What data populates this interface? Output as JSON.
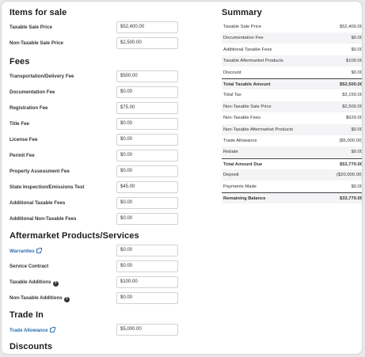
{
  "items_for_sale": {
    "title": "Items for sale",
    "rows": [
      {
        "label": "Taxable Sale Price",
        "value": "$52,400.00"
      },
      {
        "label": "Non-Taxable Sale Price",
        "value": "$2,500.00"
      }
    ]
  },
  "fees": {
    "title": "Fees",
    "rows": [
      {
        "label": "Transportation/Delivery Fee",
        "value": "$500.00"
      },
      {
        "label": "Documentation Fee",
        "value": "$0.00"
      },
      {
        "label": "Registration Fee",
        "value": "$75.00"
      },
      {
        "label": "Title Fee",
        "value": "$0.00"
      },
      {
        "label": "License Fee",
        "value": "$0.00"
      },
      {
        "label": "Permit Fee",
        "value": "$0.00"
      },
      {
        "label": "Property Assessment Fee",
        "value": "$0.00"
      },
      {
        "label": "State Inspection/Emissions Test",
        "value": "$45.00"
      },
      {
        "label": "Additional Taxable Fees",
        "value": "$0.00"
      },
      {
        "label": "Additional Non-Taxable Fees",
        "value": "$0.00"
      }
    ]
  },
  "aftermarket": {
    "title": "Aftermarket Products/Services",
    "rows": [
      {
        "label": "Warranties",
        "value": "$0.00",
        "link": true
      },
      {
        "label": "Service Contract",
        "value": "$0.00"
      },
      {
        "label": "Taxable Additions",
        "value": "$100.00",
        "help": true
      },
      {
        "label": "Non-Taxable Additions",
        "value": "$0.00",
        "help": true
      }
    ]
  },
  "trade_in": {
    "title": "Trade In",
    "rows": [
      {
        "label": "Trade Allowance",
        "value": "$5,000.00",
        "link": true
      }
    ]
  },
  "discounts": {
    "title": "Discounts"
  },
  "summary": {
    "title": "Summary",
    "rows": [
      {
        "label": "Taxable Sale Price",
        "value": "$52,400.00"
      },
      {
        "label": "Documentation Fee",
        "value": "$0.00"
      },
      {
        "label": "Additional Taxable Fees",
        "value": "$0.00"
      },
      {
        "label": "Taxable Aftermarket Products",
        "value": "$100.00"
      },
      {
        "label": "Discount",
        "value": "$0.00"
      },
      {
        "label": "Total Taxable Amount",
        "value": "$52,500.00",
        "bold": true,
        "rule": true
      },
      {
        "label": "Total Tax",
        "value": "$3,150.00"
      },
      {
        "label": "Non-Taxable Sale Price",
        "value": "$2,500.00"
      },
      {
        "label": "Non-Taxable Fees",
        "value": "$620.00"
      },
      {
        "label": "Non-Taxable Aftermarket Products",
        "value": "$0.00"
      },
      {
        "label": "Trade Allowance",
        "value": "($5,000.00)"
      },
      {
        "label": "Rebate",
        "value": "$0.00"
      },
      {
        "label": "Total Amount Due",
        "value": "$53,770.00",
        "bold": true,
        "rule": true
      },
      {
        "label": "Deposit",
        "value": "($20,000.00)"
      },
      {
        "label": "Payments Made",
        "value": "$0.00"
      },
      {
        "label": "Remaining Balance",
        "value": "$33,770.00",
        "bold": true,
        "rule": true
      }
    ]
  },
  "colors": {
    "link": "#2a6fb0",
    "alt_row": "#f4f4f6"
  }
}
